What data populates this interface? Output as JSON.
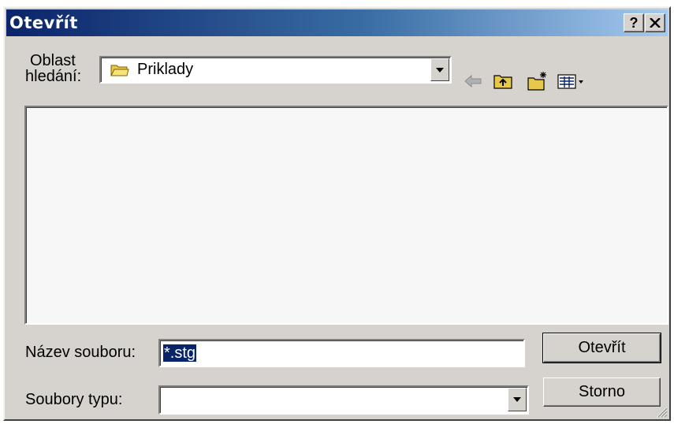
{
  "window": {
    "title": "Otevřít",
    "help_label": "?",
    "close_label": "✕"
  },
  "look_in": {
    "label_line1": "Oblast",
    "label_line2": "hledání:",
    "value": "Priklady"
  },
  "toolbar": {
    "icons": [
      "back-icon",
      "up-folder-icon",
      "new-folder-icon",
      "view-menu-icon"
    ]
  },
  "file_name": {
    "label": "Název souboru:",
    "value": "*.stg"
  },
  "file_type": {
    "label": "Soubory typu:",
    "value": ""
  },
  "buttons": {
    "open": "Otevřít",
    "cancel": "Storno"
  }
}
